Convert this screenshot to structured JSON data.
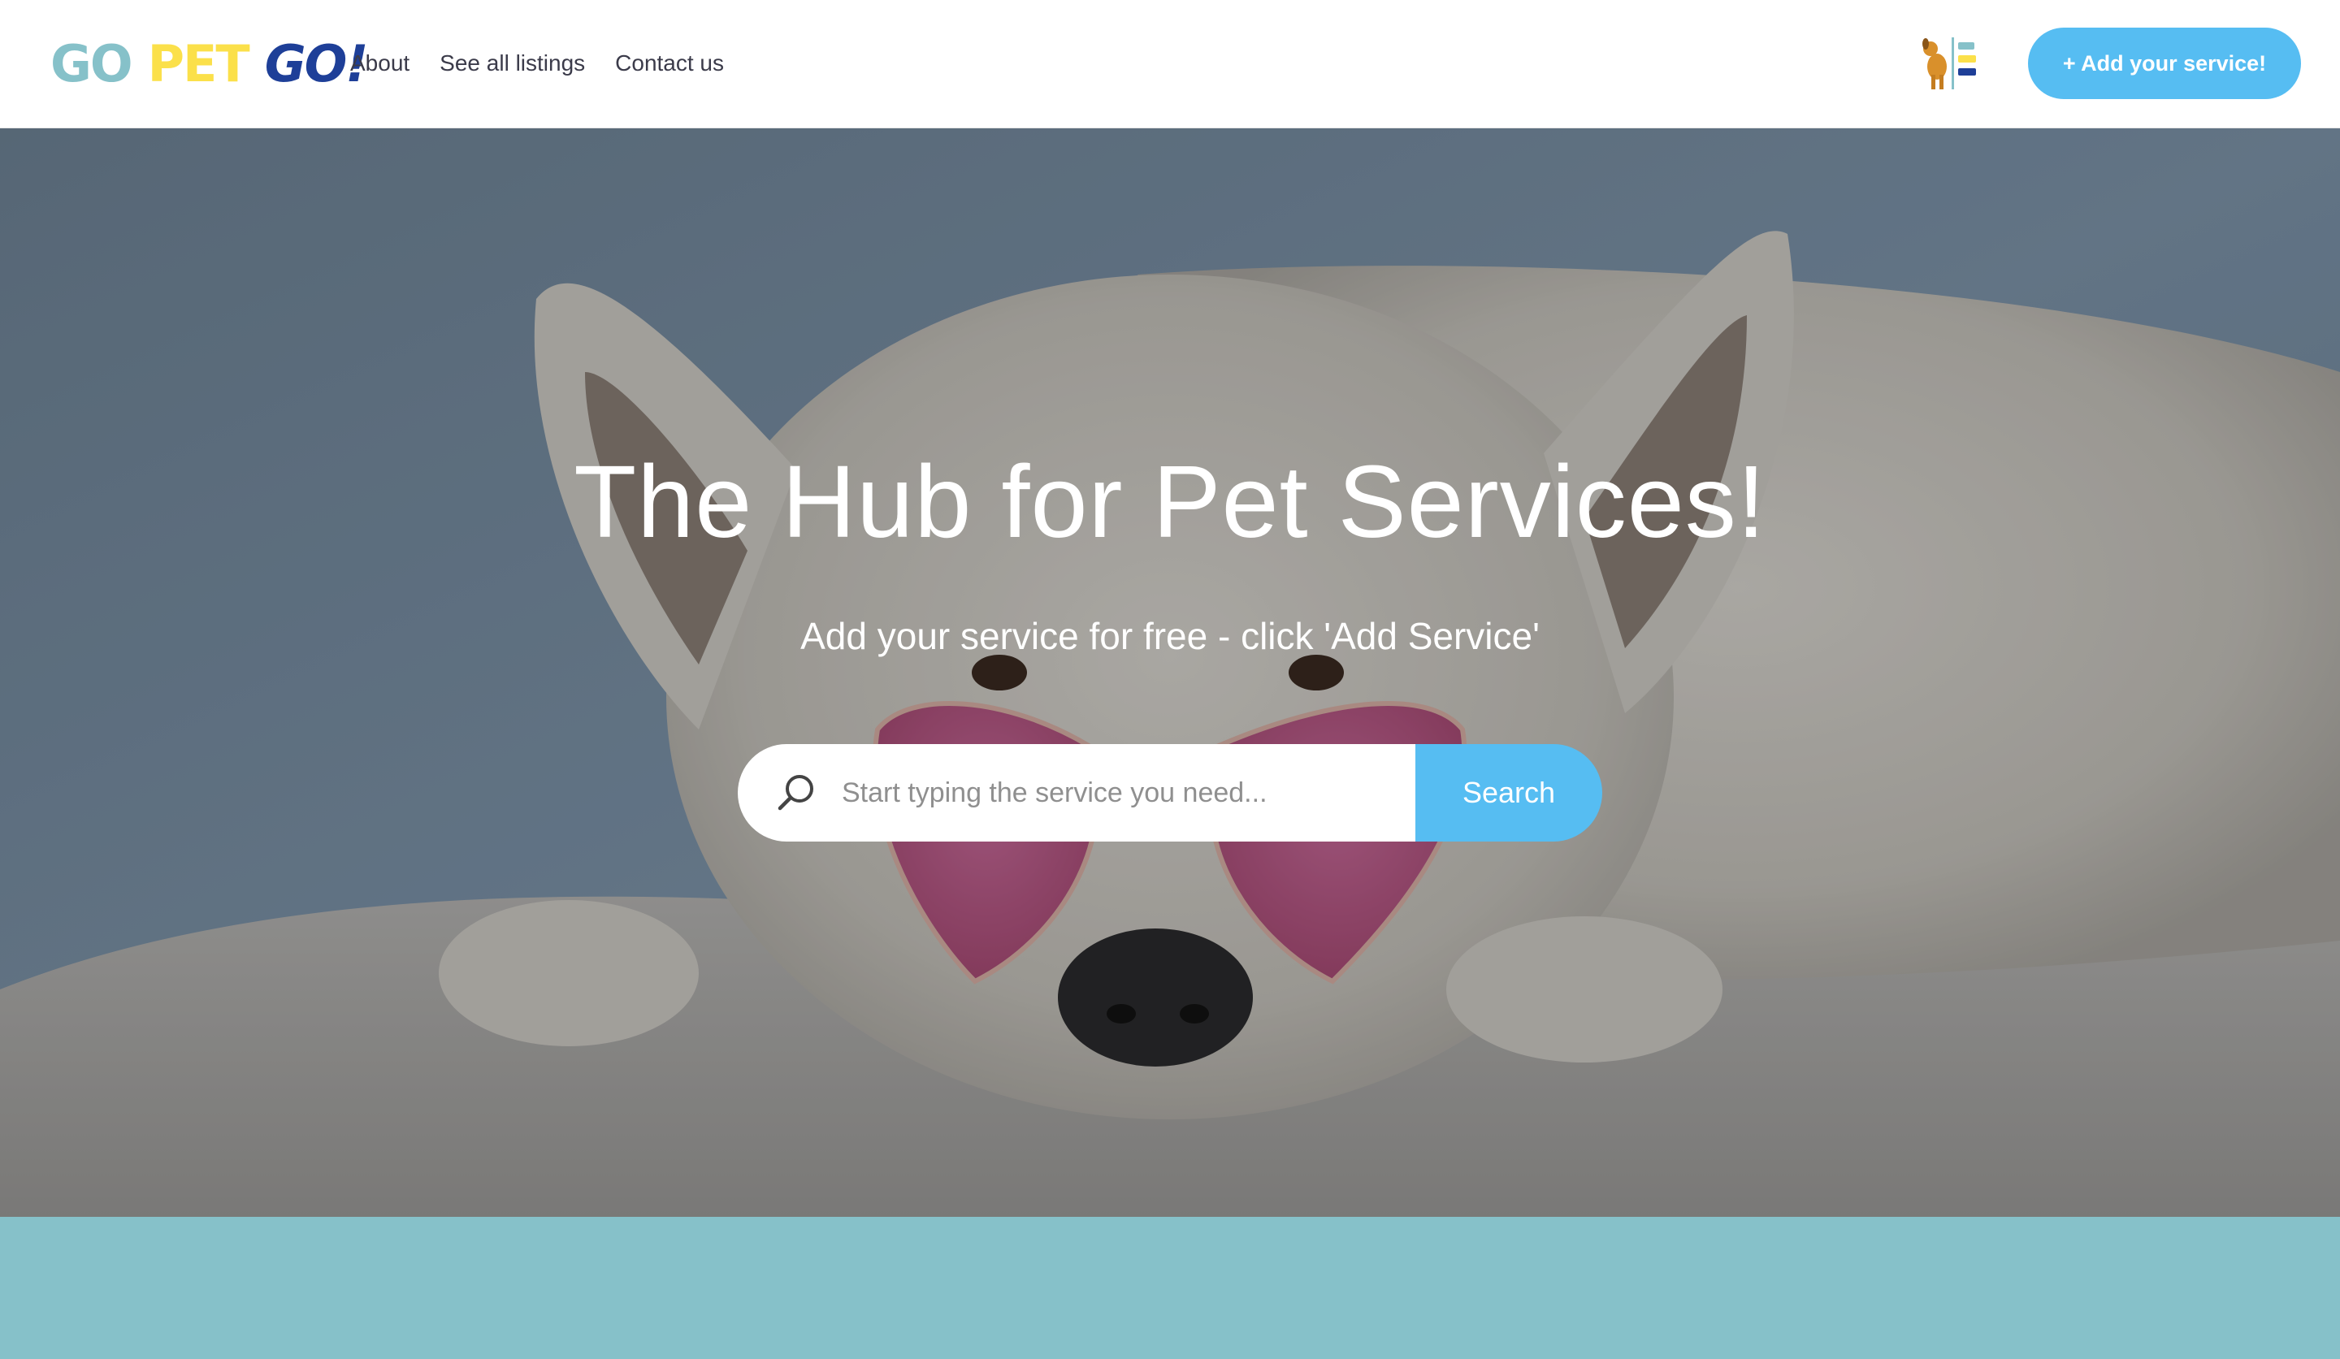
{
  "brand": {
    "word1": "GO",
    "word2": "PET",
    "word3": "GO!"
  },
  "nav": {
    "about": "About",
    "listings": "See all listings",
    "contact": "Contact us"
  },
  "header": {
    "mini_logo_alt": "GO PET GO!",
    "add_service_label": "+ Add your service!"
  },
  "hero": {
    "title": "The Hub for Pet Services!",
    "subtitle": "Add your service for free - click 'Add Service'",
    "search": {
      "placeholder": "Start typing the service you need...",
      "button_label": "Search",
      "icon": "search-icon"
    }
  },
  "colors": {
    "accent": "#56bdf2",
    "teal": "#86c1c9",
    "brand_yellow": "#fbe04a",
    "brand_navy": "#1e3f98"
  }
}
